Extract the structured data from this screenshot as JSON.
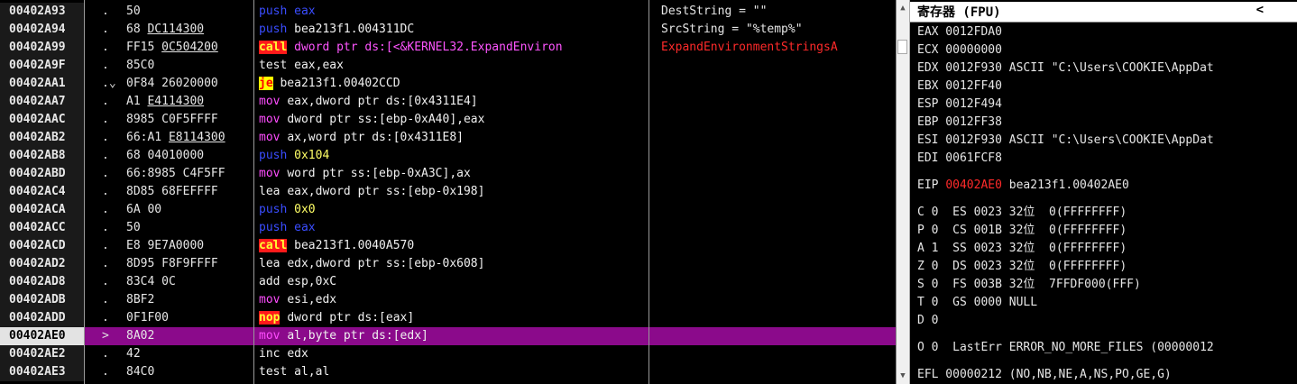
{
  "disassembly": {
    "rows": [
      {
        "addr": "00402A93",
        "flag": ".",
        "bytes": "50",
        "mnemonic": "push",
        "operands": "eax",
        "comment": "DestString = \"\""
      },
      {
        "addr": "00402A94",
        "flag": ".",
        "bytes": "68 DC114300",
        "mnemonic": "push",
        "operands": "bea213f1.004311DC",
        "comment": "SrcString = \"%temp%\""
      },
      {
        "addr": "00402A99",
        "flag": ".",
        "bytes": "FF15 0C504200",
        "mnemonic": "call",
        "operands": "dword ptr ds:[<&KERNEL32.ExpandEnviron",
        "comment": "ExpandEnvironmentStringsA"
      },
      {
        "addr": "00402A9F",
        "flag": ".",
        "bytes": "85C0",
        "mnemonic": "test",
        "operands": "eax,eax",
        "comment": ""
      },
      {
        "addr": "00402AA1",
        "flag": ".⌄",
        "bytes": "0F84 26020000",
        "mnemonic": "je",
        "operands": "bea213f1.00402CCD",
        "comment": ""
      },
      {
        "addr": "00402AA7",
        "flag": ".",
        "bytes": "A1 E4114300",
        "mnemonic": "mov",
        "operands": "eax,dword ptr ds:[0x4311E4]",
        "comment": ""
      },
      {
        "addr": "00402AAC",
        "flag": ".",
        "bytes": "8985 C0F5FFFF",
        "mnemonic": "mov",
        "operands": "dword ptr ss:[ebp-0xA40],eax",
        "comment": ""
      },
      {
        "addr": "00402AB2",
        "flag": ".",
        "bytes": "66:A1 E8114300",
        "mnemonic": "mov",
        "operands": "ax,word ptr ds:[0x4311E8]",
        "comment": ""
      },
      {
        "addr": "00402AB8",
        "flag": ".",
        "bytes": "68 04010000",
        "mnemonic": "push",
        "operands": "0x104",
        "comment": ""
      },
      {
        "addr": "00402ABD",
        "flag": ".",
        "bytes": "66:8985 C4F5FF",
        "mnemonic": "mov",
        "operands": "word ptr ss:[ebp-0xA3C],ax",
        "comment": ""
      },
      {
        "addr": "00402AC4",
        "flag": ".",
        "bytes": "8D85 68FEFFFF",
        "mnemonic": "lea",
        "operands": "eax,dword ptr ss:[ebp-0x198]",
        "comment": ""
      },
      {
        "addr": "00402ACA",
        "flag": ".",
        "bytes": "6A 00",
        "mnemonic": "push",
        "operands": "0x0",
        "comment": ""
      },
      {
        "addr": "00402ACC",
        "flag": ".",
        "bytes": "50",
        "mnemonic": "push",
        "operands": "eax",
        "comment": ""
      },
      {
        "addr": "00402ACD",
        "flag": ".",
        "bytes": "E8 9E7A0000",
        "mnemonic": "call",
        "operands": "bea213f1.0040A570",
        "comment": ""
      },
      {
        "addr": "00402AD2",
        "flag": ".",
        "bytes": "8D95 F8F9FFFF",
        "mnemonic": "lea",
        "operands": "edx,dword ptr ss:[ebp-0x608]",
        "comment": ""
      },
      {
        "addr": "00402AD8",
        "flag": ".",
        "bytes": "83C4 0C",
        "mnemonic": "add",
        "operands": "esp,0xC",
        "comment": ""
      },
      {
        "addr": "00402ADB",
        "flag": ".",
        "bytes": "8BF2",
        "mnemonic": "mov",
        "operands": "esi,edx",
        "comment": ""
      },
      {
        "addr": "00402ADD",
        "flag": ".",
        "bytes": "0F1F00",
        "mnemonic": "nop",
        "operands": "dword ptr ds:[eax]",
        "comment": ""
      },
      {
        "addr": "00402AE0",
        "flag": ">",
        "bytes": "8A02",
        "mnemonic": "mov",
        "operands": "al,byte ptr ds:[edx]",
        "comment": ""
      },
      {
        "addr": "00402AE2",
        "flag": ".",
        "bytes": "42",
        "mnemonic": "inc",
        "operands": "edx",
        "comment": ""
      },
      {
        "addr": "00402AE3",
        "flag": ".",
        "bytes": "84C0",
        "mnemonic": "test",
        "operands": "al,al",
        "comment": ""
      }
    ]
  },
  "registers": {
    "title": "寄存器 (FPU)",
    "close": "<",
    "lines": [
      "EAX 0012FDA0",
      "ECX 00000000",
      "EDX 0012F930 ASCII \"C:\\Users\\COOKIE\\AppDat",
      "EBX 0012FF40",
      "ESP 0012F494",
      "EBP 0012FF38",
      "ESI 0012F930 ASCII \"C:\\Users\\COOKIE\\AppDat",
      "EDI 0061FCF8"
    ],
    "eip_label": "EIP",
    "eip_value": "00402AE0",
    "eip_desc": "bea213f1.00402AE0",
    "flags": [
      "C 0  ES 0023 32位  0(FFFFFFFF)",
      "P 0  CS 001B 32位  0(FFFFFFFF)",
      "A 1  SS 0023 32位  0(FFFFFFFF)",
      "Z 0  DS 0023 32位  0(FFFFFFFF)",
      "S 0  FS 003B 32位  7FFDF000(FFF)",
      "T 0  GS 0000 NULL",
      "D 0"
    ],
    "lasterr": "O 0  LastErr ERROR_NO_MORE_FILES (00000012",
    "efl": "EFL 00000212 (NO,NB,NE,A,NS,PO,GE,G)"
  },
  "colors": {
    "selection": "#8b0a8b",
    "eip": "#ff2a2a",
    "push": "#3a4dff",
    "call_bg": "#ff1a1a",
    "je_bg": "#ffff00"
  }
}
